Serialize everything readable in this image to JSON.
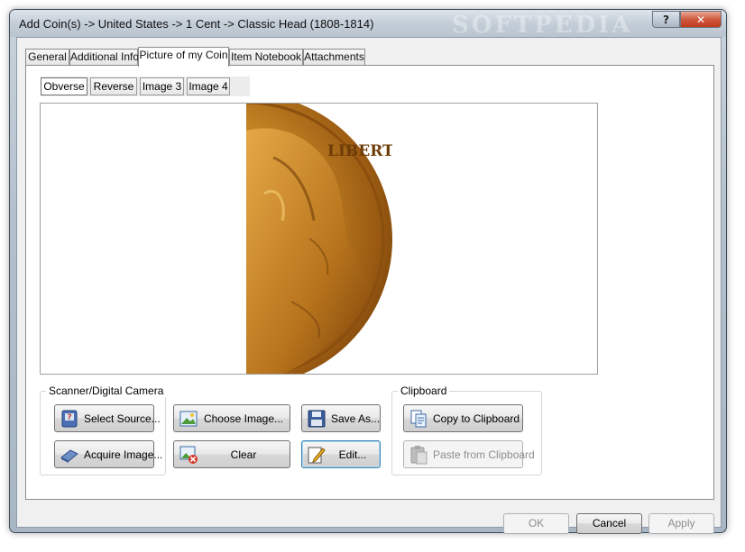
{
  "window": {
    "title": "Add Coin(s) -> United States -> 1 Cent -> Classic Head (1808-1814)",
    "help_label": "?",
    "close_label": "✕",
    "watermark": "SOFTPEDIA"
  },
  "tabs": [
    {
      "label": "General"
    },
    {
      "label": "Additional Info"
    },
    {
      "label": "Picture of my Coin",
      "active": true
    },
    {
      "label": "Item Notebook"
    },
    {
      "label": "Attachments"
    }
  ],
  "image_tabs": [
    {
      "label": "Obverse",
      "active": true
    },
    {
      "label": "Reverse"
    },
    {
      "label": "Image 3"
    },
    {
      "label": "Image 4"
    }
  ],
  "coin_image": {
    "description_icon": "coin-obverse-image",
    "inscription": "LIBERTY"
  },
  "scanner_group": {
    "label": "Scanner/Digital Camera",
    "select_source": "Select Source...",
    "acquire_image": "Acquire Image..."
  },
  "image_buttons": {
    "choose_image": "Choose Image...",
    "clear": "Clear",
    "save_as": "Save As...",
    "edit": "Edit..."
  },
  "clipboard_group": {
    "label": "Clipboard",
    "copy": "Copy to Clipboard",
    "paste": "Paste from Clipboard"
  },
  "dialog_buttons": {
    "ok": "OK",
    "cancel": "Cancel",
    "apply": "Apply"
  },
  "colors": {
    "coin_gold": "#b8741c",
    "close_button": "#c0391c",
    "focus_border": "#3c7fb1"
  }
}
